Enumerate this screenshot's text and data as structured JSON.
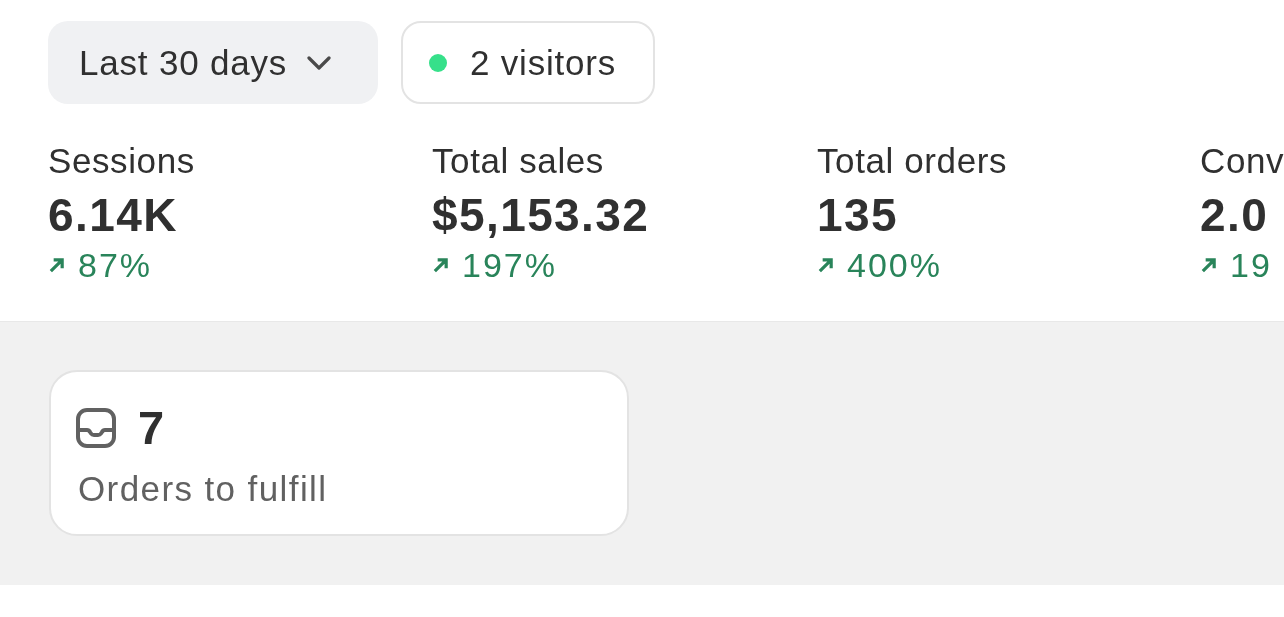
{
  "toolbar": {
    "date_range": {
      "label": "Last 30 days"
    },
    "live_visitors": {
      "label": "2 visitors"
    }
  },
  "metrics": [
    {
      "label": "Sessions",
      "value": "6.14K",
      "change": "87%",
      "rising": true
    },
    {
      "label": "Total sales",
      "value": "$5,153.32",
      "change": "197%",
      "rising": true
    },
    {
      "label": "Total orders",
      "value": "135",
      "change": "400%",
      "rising": true
    },
    {
      "label": "Conv",
      "value": "2.0",
      "change": "19",
      "rising": true
    }
  ],
  "fulfillment_card": {
    "count": "7",
    "label": "Orders to fulfill"
  }
}
